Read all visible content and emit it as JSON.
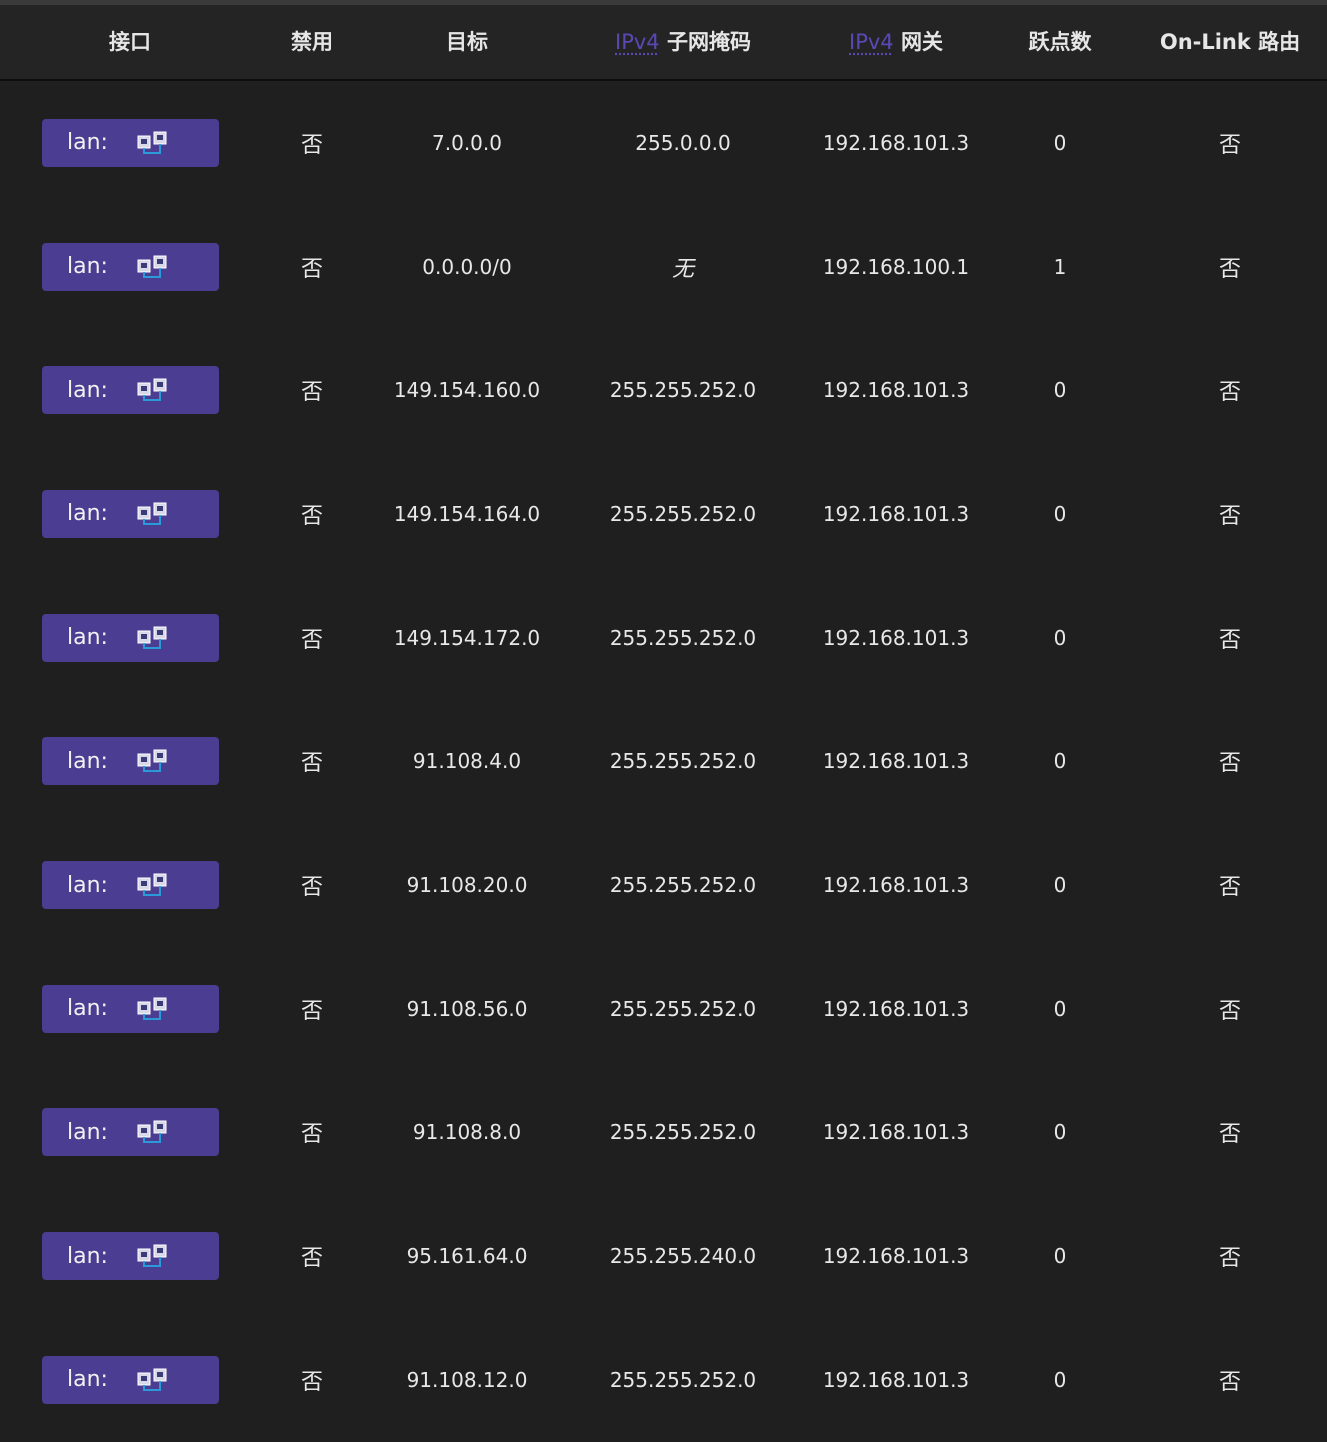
{
  "columns": {
    "interface": "接口",
    "disabled": "禁用",
    "target": "目标",
    "mask_prefix": "IPv4",
    "mask_label": "子网掩码",
    "gateway_prefix": "IPv4",
    "gateway_label": "网关",
    "metric": "跃点数",
    "onlink": "On-Link 路由"
  },
  "rows": [
    {
      "iface": "lan:",
      "iface_icon": "network-ports-icon",
      "disabled": "否",
      "target": "7.0.0.0",
      "mask": "255.0.0.0",
      "gateway": "192.168.101.3",
      "metric": "0",
      "onlink": "否"
    },
    {
      "iface": "lan:",
      "iface_icon": "network-ports-icon",
      "disabled": "否",
      "target": "0.0.0.0/0",
      "mask": "无",
      "gateway": "192.168.100.1",
      "metric": "1",
      "onlink": "否"
    },
    {
      "iface": "lan:",
      "iface_icon": "network-ports-icon",
      "disabled": "否",
      "target": "149.154.160.0",
      "mask": "255.255.252.0",
      "gateway": "192.168.101.3",
      "metric": "0",
      "onlink": "否"
    },
    {
      "iface": "lan:",
      "iface_icon": "network-ports-icon",
      "disabled": "否",
      "target": "149.154.164.0",
      "mask": "255.255.252.0",
      "gateway": "192.168.101.3",
      "metric": "0",
      "onlink": "否"
    },
    {
      "iface": "lan:",
      "iface_icon": "network-ports-icon",
      "disabled": "否",
      "target": "149.154.172.0",
      "mask": "255.255.252.0",
      "gateway": "192.168.101.3",
      "metric": "0",
      "onlink": "否"
    },
    {
      "iface": "lan:",
      "iface_icon": "network-ports-icon",
      "disabled": "否",
      "target": "91.108.4.0",
      "mask": "255.255.252.0",
      "gateway": "192.168.101.3",
      "metric": "0",
      "onlink": "否"
    },
    {
      "iface": "lan:",
      "iface_icon": "network-ports-icon",
      "disabled": "否",
      "target": "91.108.20.0",
      "mask": "255.255.252.0",
      "gateway": "192.168.101.3",
      "metric": "0",
      "onlink": "否"
    },
    {
      "iface": "lan:",
      "iface_icon": "network-ports-icon",
      "disabled": "否",
      "target": "91.108.56.0",
      "mask": "255.255.252.0",
      "gateway": "192.168.101.3",
      "metric": "0",
      "onlink": "否"
    },
    {
      "iface": "lan:",
      "iface_icon": "network-ports-icon",
      "disabled": "否",
      "target": "91.108.8.0",
      "mask": "255.255.252.0",
      "gateway": "192.168.101.3",
      "metric": "0",
      "onlink": "否"
    },
    {
      "iface": "lan:",
      "iface_icon": "network-ports-icon",
      "disabled": "否",
      "target": "95.161.64.0",
      "mask": "255.255.240.0",
      "gateway": "192.168.101.3",
      "metric": "0",
      "onlink": "否"
    },
    {
      "iface": "lan:",
      "iface_icon": "network-ports-icon",
      "disabled": "否",
      "target": "91.108.12.0",
      "mask": "255.255.252.0",
      "gateway": "192.168.101.3",
      "metric": "0",
      "onlink": "否"
    }
  ],
  "colors": {
    "background": "#1f1f1f",
    "header_background": "#242424",
    "badge": "#4b3d91",
    "abbr_accent": "#5a49b5"
  }
}
